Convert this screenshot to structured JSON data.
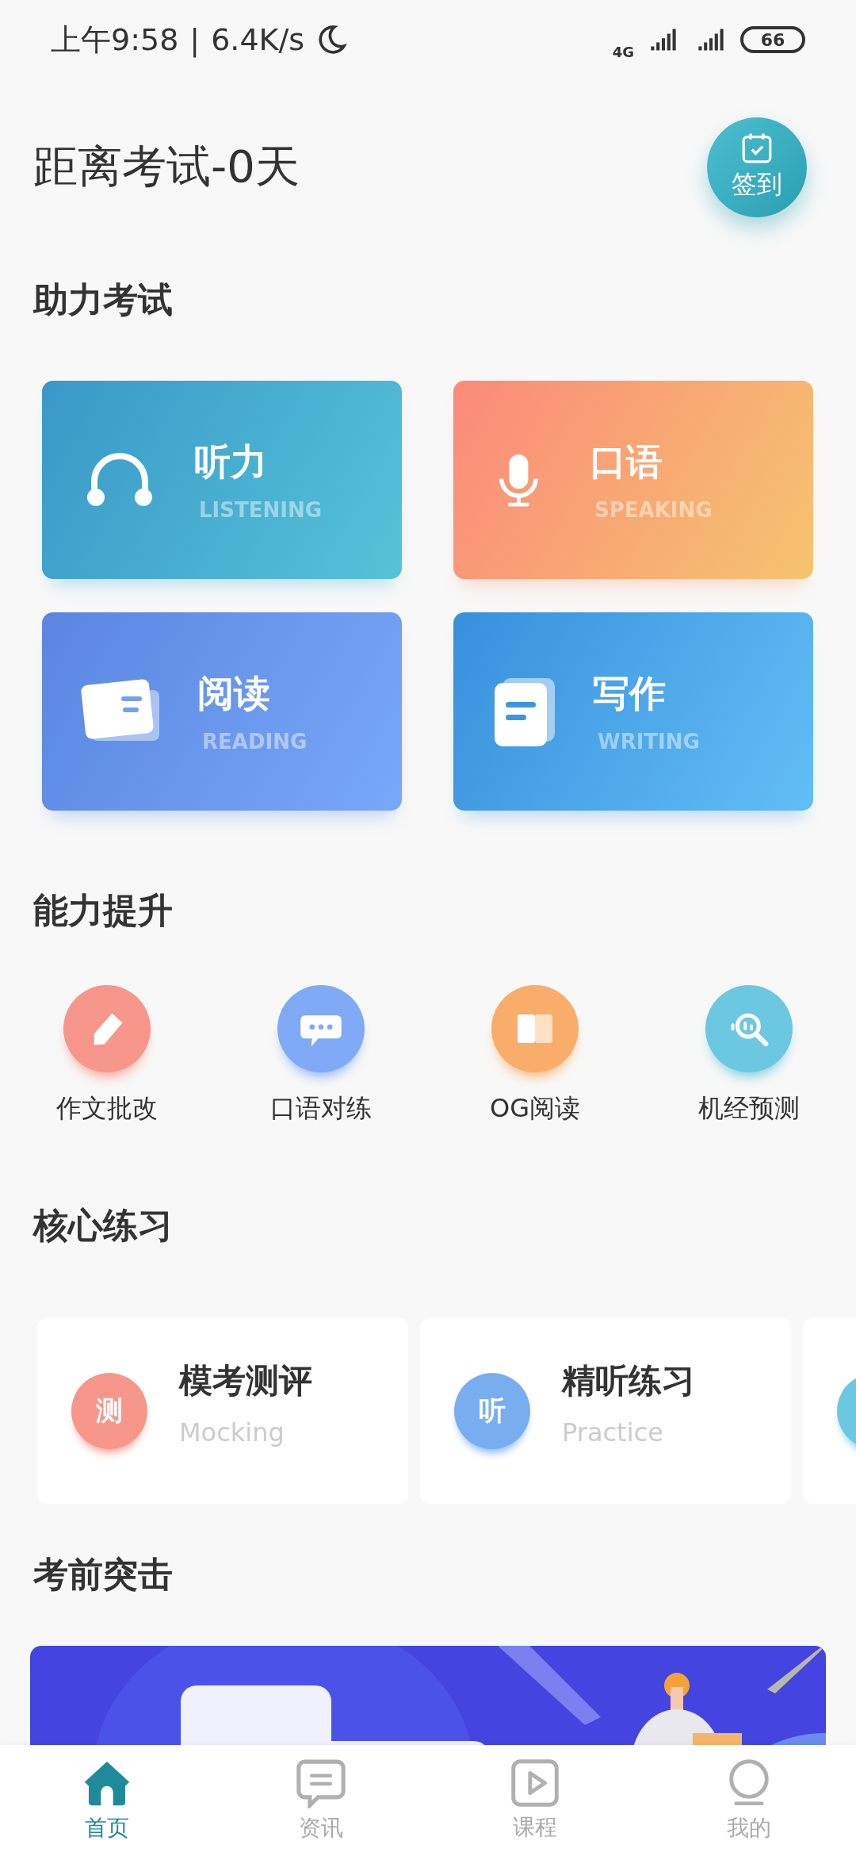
{
  "status_bar": {
    "time": "上午9:58",
    "separator": "|",
    "speed": "6.4K/s",
    "network": "4G",
    "battery": "66"
  },
  "header": {
    "title": "距离考试-0天",
    "checkin_label": "签到"
  },
  "exam_section": {
    "title": "助力考试",
    "cards": [
      {
        "kind": "listening",
        "title": "听力",
        "subtitle": "LISTENING"
      },
      {
        "kind": "speaking",
        "title": "口语",
        "subtitle": "SPEAKING"
      },
      {
        "kind": "reading",
        "title": "阅读",
        "subtitle": "READING"
      },
      {
        "kind": "writing",
        "title": "写作",
        "subtitle": "WRITING"
      }
    ]
  },
  "ability_section": {
    "title": "能力提升",
    "items": [
      {
        "kind": "pencil",
        "label": "作文批改",
        "color": "#f7968a"
      },
      {
        "kind": "chat",
        "label": "口语对练",
        "color": "#80aaf5"
      },
      {
        "kind": "book",
        "label": "OG阅读",
        "color": "#f8ad6a"
      },
      {
        "kind": "search",
        "label": "机经预测",
        "color": "#6cc8e0"
      }
    ]
  },
  "core_section": {
    "title": "核心练习",
    "cards": [
      {
        "badge": "测",
        "title": "模考测评",
        "subtitle": "Mocking",
        "color": "#f7968a"
      },
      {
        "badge": "听",
        "title": "精听练习",
        "subtitle": "Practice",
        "color": "#78aef0"
      },
      {
        "color": "#6cc8e0"
      }
    ]
  },
  "sprint_section": {
    "title": "考前突击"
  },
  "bottom_nav": [
    {
      "kind": "home",
      "label": "首页",
      "selected": true
    },
    {
      "kind": "news",
      "label": "资讯",
      "selected": false
    },
    {
      "kind": "course",
      "label": "课程",
      "selected": false
    },
    {
      "kind": "profile",
      "label": "我的",
      "selected": false
    }
  ]
}
